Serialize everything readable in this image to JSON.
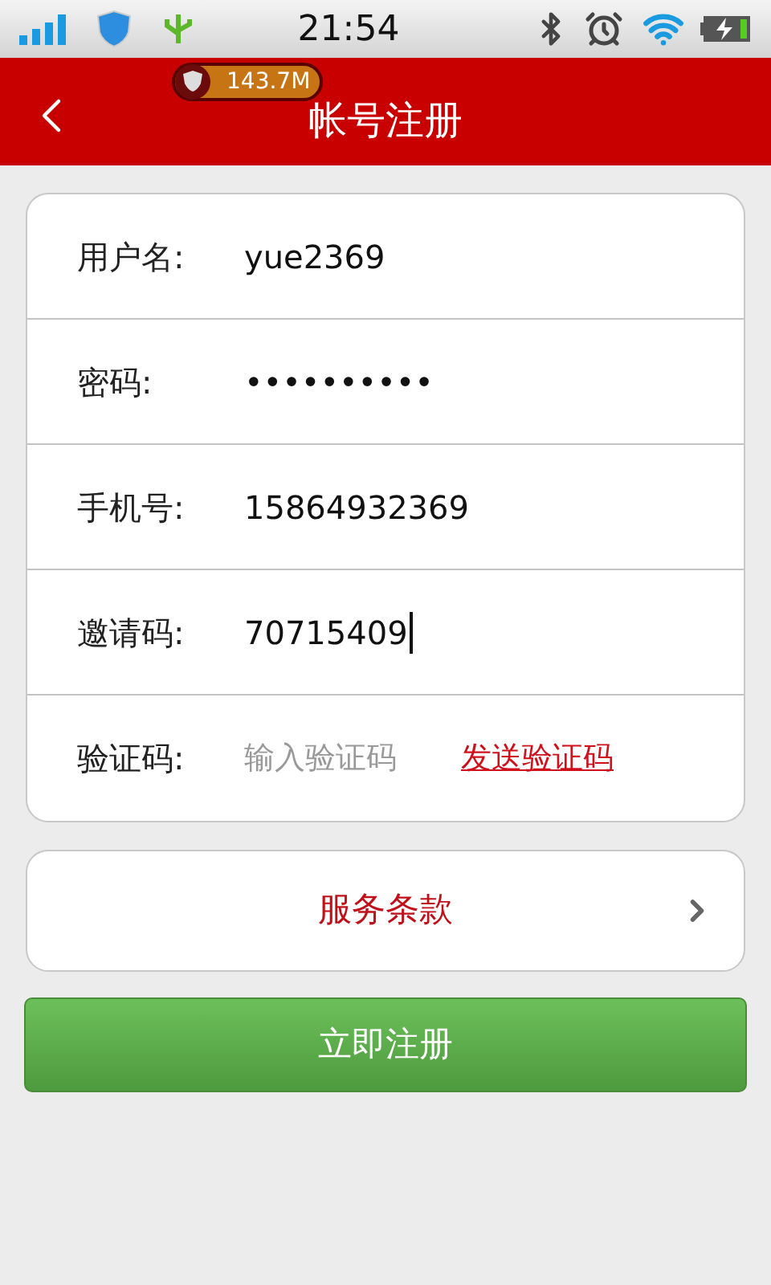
{
  "status_bar": {
    "time": "21:54"
  },
  "header": {
    "title": "帐号注册",
    "badge": "143.7M"
  },
  "form": {
    "fields": [
      {
        "kind": "text",
        "label": "用户名:",
        "value": "yue2369",
        "focused": false
      },
      {
        "kind": "text",
        "label": "密码:",
        "value": "••••••••••",
        "focused": false
      },
      {
        "kind": "text",
        "label": "手机号:",
        "value": "15864932369",
        "focused": false
      },
      {
        "kind": "text",
        "label": "邀请码:",
        "value": "70715409",
        "focused": true
      },
      {
        "kind": "code",
        "label": "验证码:",
        "placeholder": "输入验证码",
        "link": "发送验证码",
        "focused": false
      }
    ]
  },
  "terms": {
    "label": "服务条款"
  },
  "submit": {
    "label": "立即注册"
  }
}
